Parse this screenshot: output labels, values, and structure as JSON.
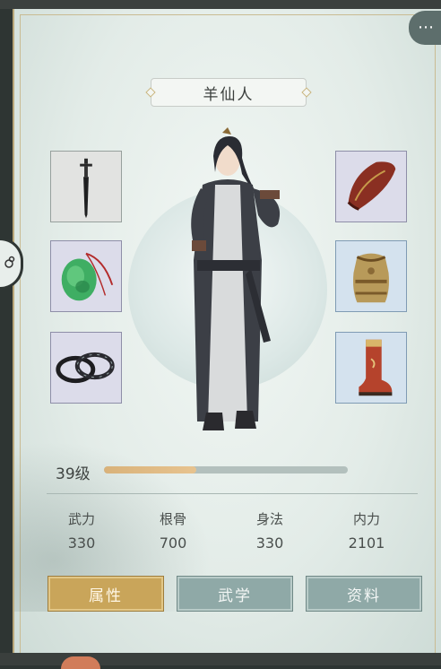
{
  "character": {
    "name": "羊仙人",
    "level_label": "39级",
    "level_progress": 0.38
  },
  "equipment": {
    "left": [
      {
        "icon": "dagger-icon",
        "rarity": "grey"
      },
      {
        "icon": "jade-pendant-icon",
        "rarity": "purple"
      },
      {
        "icon": "bracelet-icon",
        "rarity": "purple"
      }
    ],
    "right": [
      {
        "icon": "hat-icon",
        "rarity": "purple"
      },
      {
        "icon": "armor-icon",
        "rarity": "blue"
      },
      {
        "icon": "boots-icon",
        "rarity": "blue"
      }
    ]
  },
  "stats": [
    {
      "label": "武力",
      "value": "330"
    },
    {
      "label": "根骨",
      "value": "700"
    },
    {
      "label": "身法",
      "value": "330"
    },
    {
      "label": "内力",
      "value": "2101"
    }
  ],
  "tabs": [
    {
      "label": "属性",
      "active": true
    },
    {
      "label": "武学",
      "active": false
    },
    {
      "label": "资料",
      "active": false
    }
  ],
  "colors": {
    "accent_gold": "#c9a55a",
    "tab_inactive": "#8fa9a7",
    "progress_fill": "#e0bb85"
  }
}
